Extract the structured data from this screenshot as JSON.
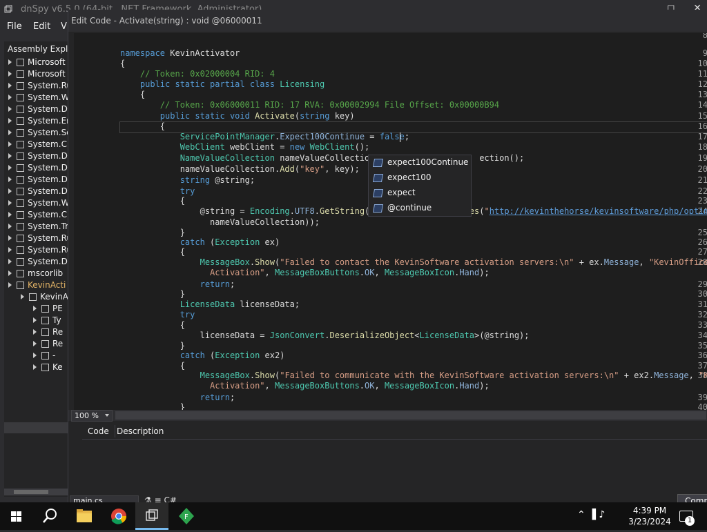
{
  "main_window": {
    "title": "dnSpy v6.5.0 (64-bit, .NET Framework, Administrator)",
    "menu": [
      "File",
      "Edit",
      "V"
    ],
    "assembly_explorer": {
      "header": "Assembly Explorer",
      "items": [
        "Microsoft",
        "Microsoft",
        "System.Ru",
        "System.W",
        "System.D",
        "System.En",
        "System.Se",
        "System.C",
        "System.D",
        "System.D",
        "System.D",
        "System.D",
        "System.W",
        "System.C",
        "System.Tr",
        "System.Ru",
        "System.Ru",
        "System.D",
        "mscorlib",
        "KevinActi",
        "KevinA",
        "PE",
        "Ty",
        "Re",
        "Re",
        "-",
        "Ke"
      ]
    }
  },
  "dialog": {
    "title": "Edit Code - Activate(string) : void @06000011",
    "zoom": "100 %",
    "errors_columns": [
      "Code",
      "Description"
    ],
    "file_combo": "main.cs",
    "compile_label": "Compile",
    "tool_glyphs": "⚗  ≡  C#"
  },
  "completion": [
    "expect100Continue",
    "expect100",
    "expect",
    "@continue"
  ],
  "colors": {
    "keyword": "#569cd6",
    "type": "#4ec9b0",
    "comment": "#57a64a",
    "string": "#d69d85",
    "link": "#5e9ddb",
    "member": "#8fb3d9"
  },
  "taskbar": {
    "time": "4:39 PM",
    "date": "3/23/2024",
    "notifications": "1",
    "tray": "⌃  ▐  ♪"
  }
}
